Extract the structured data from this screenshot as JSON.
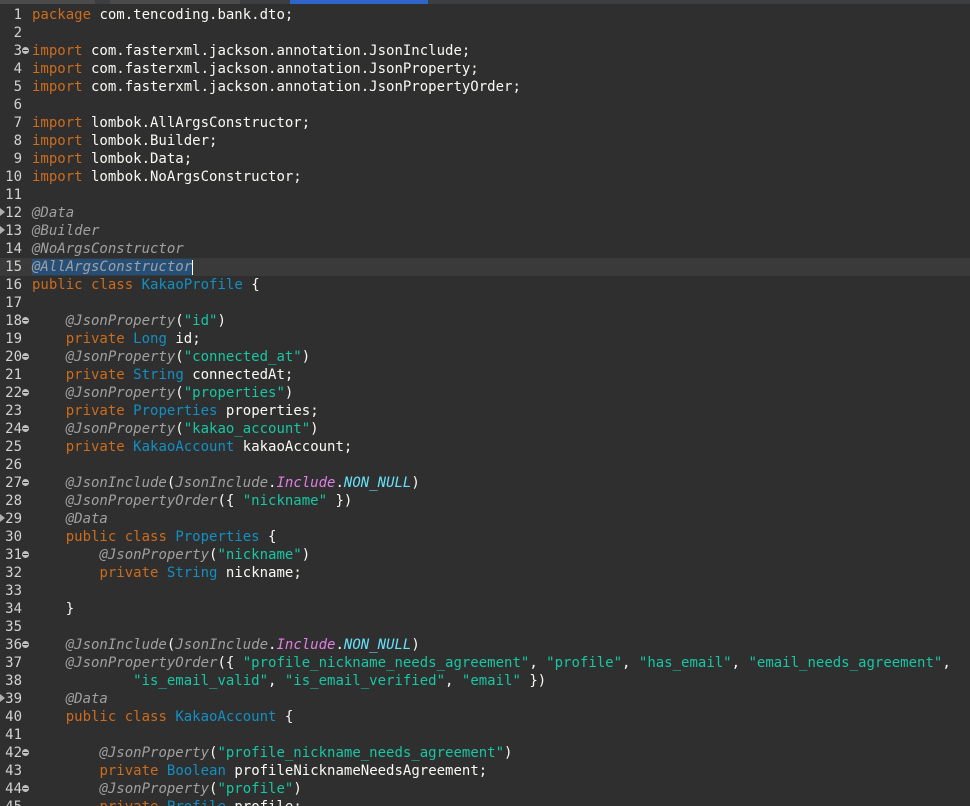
{
  "editor": {
    "lines": [
      {
        "n": "1",
        "tokens": [
          [
            "kw",
            "package"
          ],
          [
            "pu",
            " com.tencoding.bank.dto;"
          ]
        ]
      },
      {
        "n": "2",
        "tokens": []
      },
      {
        "n": "3",
        "fold": true,
        "tokens": [
          [
            "kw",
            "import"
          ],
          [
            "pu",
            " com.fasterxml.jackson.annotation.JsonInclude;"
          ]
        ]
      },
      {
        "n": "4",
        "tokens": [
          [
            "kw",
            "import"
          ],
          [
            "pu",
            " com.fasterxml.jackson.annotation.JsonProperty;"
          ]
        ]
      },
      {
        "n": "5",
        "tokens": [
          [
            "kw",
            "import"
          ],
          [
            "pu",
            " com.fasterxml.jackson.annotation.JsonPropertyOrder;"
          ]
        ]
      },
      {
        "n": "6",
        "tokens": []
      },
      {
        "n": "7",
        "tokens": [
          [
            "kw",
            "import"
          ],
          [
            "pu",
            " lombok.AllArgsConstructor;"
          ]
        ]
      },
      {
        "n": "8",
        "tokens": [
          [
            "kw",
            "import"
          ],
          [
            "pu",
            " lombok.Builder;"
          ]
        ]
      },
      {
        "n": "9",
        "tokens": [
          [
            "kw",
            "import"
          ],
          [
            "pu",
            " lombok.Data;"
          ]
        ]
      },
      {
        "n": "10",
        "tokens": [
          [
            "kw",
            "import"
          ],
          [
            "pu",
            " lombok.NoArgsConstructor;"
          ]
        ]
      },
      {
        "n": "11",
        "tokens": []
      },
      {
        "n": "12",
        "marker": true,
        "tokens": [
          [
            "an",
            "@Data"
          ]
        ]
      },
      {
        "n": "13",
        "marker": true,
        "tokens": [
          [
            "an",
            "@Builder"
          ]
        ]
      },
      {
        "n": "14",
        "tokens": [
          [
            "an",
            "@NoArgsConstructor"
          ]
        ]
      },
      {
        "n": "15",
        "current": true,
        "tokens": [
          [
            "an sel",
            "@AllArgsConstructor"
          ],
          [
            "caret",
            ""
          ]
        ]
      },
      {
        "n": "16",
        "tokens": [
          [
            "kw",
            "public"
          ],
          [
            "pu",
            " "
          ],
          [
            "kw",
            "class"
          ],
          [
            "pu",
            " "
          ],
          [
            "ty",
            "KakaoProfile"
          ],
          [
            "pu",
            " {"
          ]
        ]
      },
      {
        "n": "17",
        "tokens": []
      },
      {
        "n": "18",
        "fold": true,
        "tokens": [
          [
            "pu",
            "    "
          ],
          [
            "an",
            "@JsonProperty"
          ],
          [
            "pu",
            "("
          ],
          [
            "st",
            "\"id\""
          ],
          [
            "pu",
            ")"
          ]
        ]
      },
      {
        "n": "19",
        "tokens": [
          [
            "pu",
            "    "
          ],
          [
            "kw",
            "private"
          ],
          [
            "pu",
            " "
          ],
          [
            "ty",
            "Long"
          ],
          [
            "pu",
            " "
          ],
          [
            "cf",
            "id"
          ],
          [
            "pu",
            ";"
          ]
        ]
      },
      {
        "n": "20",
        "fold": true,
        "tokens": [
          [
            "pu",
            "    "
          ],
          [
            "an",
            "@JsonProperty"
          ],
          [
            "pu",
            "("
          ],
          [
            "st",
            "\"connected_at\""
          ],
          [
            "pu",
            ")"
          ]
        ]
      },
      {
        "n": "21",
        "tokens": [
          [
            "pu",
            "    "
          ],
          [
            "kw",
            "private"
          ],
          [
            "pu",
            " "
          ],
          [
            "ty",
            "String"
          ],
          [
            "pu",
            " "
          ],
          [
            "cf",
            "connectedAt"
          ],
          [
            "pu",
            ";"
          ]
        ]
      },
      {
        "n": "22",
        "fold": true,
        "tokens": [
          [
            "pu",
            "    "
          ],
          [
            "an",
            "@JsonProperty"
          ],
          [
            "pu",
            "("
          ],
          [
            "st",
            "\"properties\""
          ],
          [
            "pu",
            ")"
          ]
        ]
      },
      {
        "n": "23",
        "tokens": [
          [
            "pu",
            "    "
          ],
          [
            "kw",
            "private"
          ],
          [
            "pu",
            " "
          ],
          [
            "ty",
            "Properties"
          ],
          [
            "pu",
            " "
          ],
          [
            "cf",
            "properties"
          ],
          [
            "pu",
            ";"
          ]
        ]
      },
      {
        "n": "24",
        "fold": true,
        "tokens": [
          [
            "pu",
            "    "
          ],
          [
            "an",
            "@JsonProperty"
          ],
          [
            "pu",
            "("
          ],
          [
            "st",
            "\"kakao_account\""
          ],
          [
            "pu",
            ")"
          ]
        ]
      },
      {
        "n": "25",
        "tokens": [
          [
            "pu",
            "    "
          ],
          [
            "kw",
            "private"
          ],
          [
            "pu",
            " "
          ],
          [
            "ty",
            "KakaoAccount"
          ],
          [
            "pu",
            " "
          ],
          [
            "cf",
            "kakaoAccount"
          ],
          [
            "pu",
            ";"
          ]
        ]
      },
      {
        "n": "26",
        "tokens": []
      },
      {
        "n": "27",
        "fold": true,
        "tokens": [
          [
            "pu",
            "    "
          ],
          [
            "an",
            "@JsonInclude"
          ],
          [
            "pu",
            "("
          ],
          [
            "an",
            "JsonInclude"
          ],
          [
            "pu",
            "."
          ],
          [
            "inc",
            "Include"
          ],
          [
            "pu",
            "."
          ],
          [
            "en",
            "NON_NULL"
          ],
          [
            "pu",
            ")"
          ]
        ]
      },
      {
        "n": "28",
        "tokens": [
          [
            "pu",
            "    "
          ],
          [
            "an",
            "@JsonPropertyOrder"
          ],
          [
            "pu",
            "({ "
          ],
          [
            "st",
            "\"nickname\""
          ],
          [
            "pu",
            " })"
          ]
        ]
      },
      {
        "n": "29",
        "marker": true,
        "tokens": [
          [
            "pu",
            "    "
          ],
          [
            "an",
            "@Data"
          ]
        ]
      },
      {
        "n": "30",
        "tokens": [
          [
            "pu",
            "    "
          ],
          [
            "kw",
            "public"
          ],
          [
            "pu",
            " "
          ],
          [
            "kw",
            "class"
          ],
          [
            "pu",
            " "
          ],
          [
            "ty",
            "Properties"
          ],
          [
            "pu",
            " {"
          ]
        ]
      },
      {
        "n": "31",
        "fold": true,
        "tokens": [
          [
            "pu",
            "        "
          ],
          [
            "an",
            "@JsonProperty"
          ],
          [
            "pu",
            "("
          ],
          [
            "st",
            "\"nickname\""
          ],
          [
            "pu",
            ")"
          ]
        ]
      },
      {
        "n": "32",
        "tokens": [
          [
            "pu",
            "        "
          ],
          [
            "kw",
            "private"
          ],
          [
            "pu",
            " "
          ],
          [
            "ty",
            "String"
          ],
          [
            "pu",
            " "
          ],
          [
            "cf",
            "nickname"
          ],
          [
            "pu",
            ";"
          ]
        ]
      },
      {
        "n": "33",
        "tokens": []
      },
      {
        "n": "34",
        "tokens": [
          [
            "pu",
            "    }"
          ]
        ]
      },
      {
        "n": "35",
        "tokens": []
      },
      {
        "n": "36",
        "fold": true,
        "tokens": [
          [
            "pu",
            "    "
          ],
          [
            "an",
            "@JsonInclude"
          ],
          [
            "pu",
            "("
          ],
          [
            "an",
            "JsonInclude"
          ],
          [
            "pu",
            "."
          ],
          [
            "inc",
            "Include"
          ],
          [
            "pu",
            "."
          ],
          [
            "en",
            "NON_NULL"
          ],
          [
            "pu",
            ")"
          ]
        ]
      },
      {
        "n": "37",
        "tokens": [
          [
            "pu",
            "    "
          ],
          [
            "an",
            "@JsonPropertyOrder"
          ],
          [
            "pu",
            "({ "
          ],
          [
            "st",
            "\"profile_nickname_needs_agreement\""
          ],
          [
            "pu",
            ", "
          ],
          [
            "st",
            "\"profile\""
          ],
          [
            "pu",
            ", "
          ],
          [
            "st",
            "\"has_email\""
          ],
          [
            "pu",
            ", "
          ],
          [
            "st",
            "\"email_needs_agreement\""
          ],
          [
            "pu",
            ","
          ]
        ]
      },
      {
        "n": "38",
        "tokens": [
          [
            "pu",
            "            "
          ],
          [
            "st",
            "\"is_email_valid\""
          ],
          [
            "pu",
            ", "
          ],
          [
            "st",
            "\"is_email_verified\""
          ],
          [
            "pu",
            ", "
          ],
          [
            "st",
            "\"email\""
          ],
          [
            "pu",
            " })"
          ]
        ]
      },
      {
        "n": "39",
        "marker": true,
        "tokens": [
          [
            "pu",
            "    "
          ],
          [
            "an",
            "@Data"
          ]
        ]
      },
      {
        "n": "40",
        "tokens": [
          [
            "pu",
            "    "
          ],
          [
            "kw",
            "public"
          ],
          [
            "pu",
            " "
          ],
          [
            "kw",
            "class"
          ],
          [
            "pu",
            " "
          ],
          [
            "ty",
            "KakaoAccount"
          ],
          [
            "pu",
            " {"
          ]
        ]
      },
      {
        "n": "41",
        "tokens": []
      },
      {
        "n": "42",
        "fold": true,
        "tokens": [
          [
            "pu",
            "        "
          ],
          [
            "an",
            "@JsonProperty"
          ],
          [
            "pu",
            "("
          ],
          [
            "st",
            "\"profile_nickname_needs_agreement\""
          ],
          [
            "pu",
            ")"
          ]
        ]
      },
      {
        "n": "43",
        "tokens": [
          [
            "pu",
            "        "
          ],
          [
            "kw",
            "private"
          ],
          [
            "pu",
            " "
          ],
          [
            "ty",
            "Boolean"
          ],
          [
            "pu",
            " "
          ],
          [
            "cf",
            "profileNicknameNeedsAgreement"
          ],
          [
            "pu",
            ";"
          ]
        ]
      },
      {
        "n": "44",
        "fold": true,
        "tokens": [
          [
            "pu",
            "        "
          ],
          [
            "an",
            "@JsonProperty"
          ],
          [
            "pu",
            "("
          ],
          [
            "st",
            "\"profile\""
          ],
          [
            "pu",
            ")"
          ]
        ]
      },
      {
        "n": "45",
        "tokens": [
          [
            "pu",
            "        "
          ],
          [
            "kw",
            "private"
          ],
          [
            "pu",
            " "
          ],
          [
            "ty",
            "Profile"
          ],
          [
            "pu",
            " "
          ],
          [
            "cf",
            "profile"
          ],
          [
            "pu",
            ";"
          ]
        ]
      }
    ]
  }
}
